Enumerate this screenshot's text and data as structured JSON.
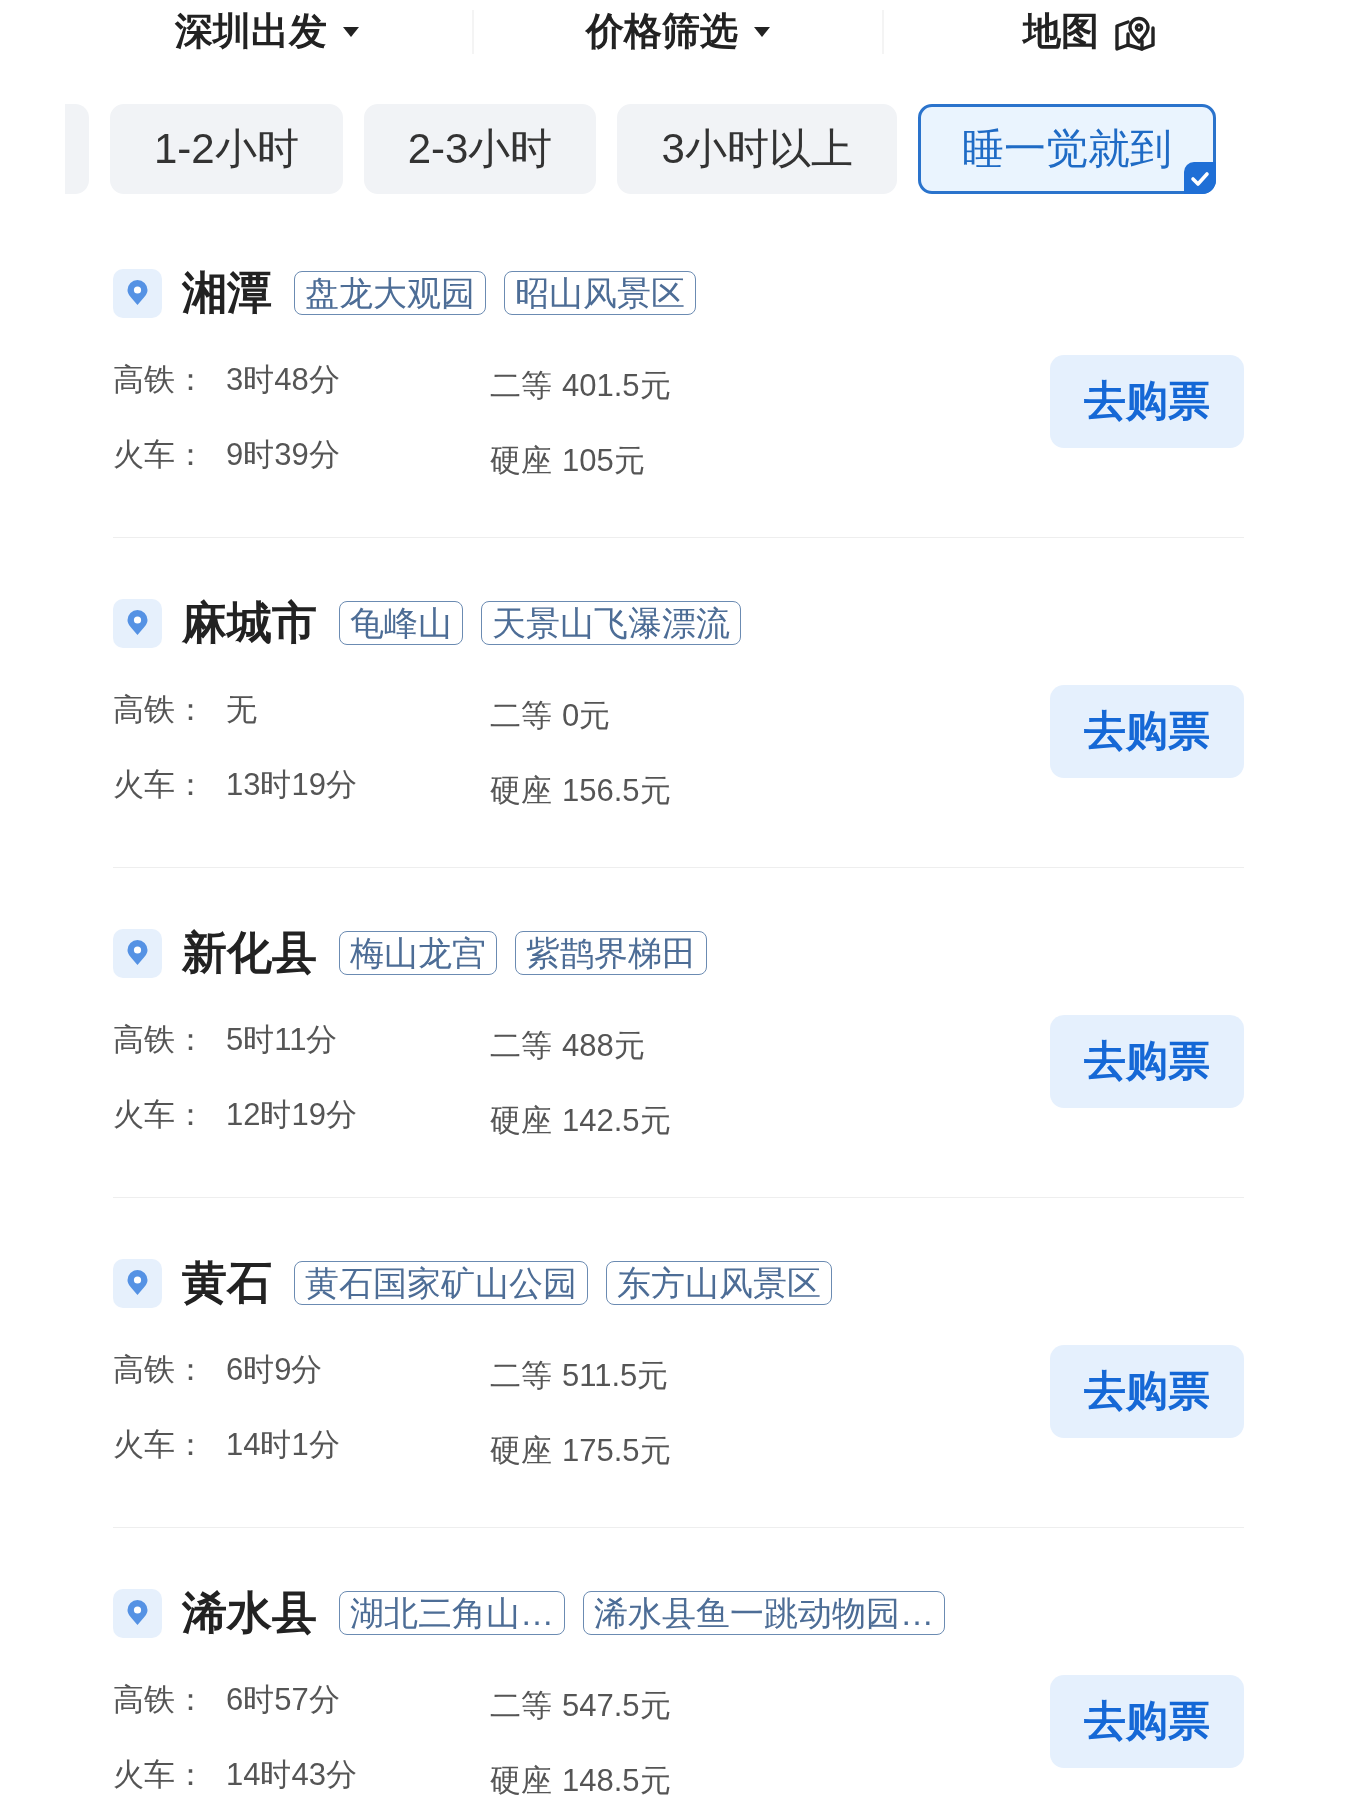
{
  "top_bar": {
    "items": [
      {
        "kind": "dropdown",
        "label": "深圳出发"
      },
      {
        "kind": "dropdown",
        "label": "价格筛选"
      },
      {
        "kind": "map",
        "label": "地图"
      }
    ]
  },
  "duration_filters": [
    {
      "label": "1-2小时",
      "selected": false
    },
    {
      "label": "2-3小时",
      "selected": false
    },
    {
      "label": "3小时以上",
      "selected": false
    },
    {
      "label": "睡一觉就到",
      "selected": true
    }
  ],
  "destinations": [
    {
      "name": "湘潭",
      "tags": [
        "盘龙大观园",
        "昭山风景区"
      ],
      "fares": [
        {
          "label": "高铁：",
          "duration": "3时48分",
          "seat": "二等",
          "price": "401.5元"
        },
        {
          "label": "火车：",
          "duration": "9时39分",
          "seat": "硬座",
          "price": "105元"
        }
      ],
      "button": "去购票"
    },
    {
      "name": "麻城市",
      "tags": [
        "龟峰山",
        "天景山飞瀑漂流"
      ],
      "fares": [
        {
          "label": "高铁：",
          "duration": "无",
          "seat": "二等",
          "price": "0元"
        },
        {
          "label": "火车：",
          "duration": "13时19分",
          "seat": "硬座",
          "price": "156.5元"
        }
      ],
      "button": "去购票"
    },
    {
      "name": "新化县",
      "tags": [
        "梅山龙宫",
        "紫鹊界梯田"
      ],
      "fares": [
        {
          "label": "高铁：",
          "duration": "5时11分",
          "seat": "二等",
          "price": "488元"
        },
        {
          "label": "火车：",
          "duration": "12时19分",
          "seat": "硬座",
          "price": "142.5元"
        }
      ],
      "button": "去购票"
    },
    {
      "name": "黄石",
      "tags": [
        "黄石国家矿山公园",
        "东方山风景区"
      ],
      "fares": [
        {
          "label": "高铁：",
          "duration": "6时9分",
          "seat": "二等",
          "price": "511.5元"
        },
        {
          "label": "火车：",
          "duration": "14时1分",
          "seat": "硬座",
          "price": "175.5元"
        }
      ],
      "button": "去购票"
    },
    {
      "name": "浠水县",
      "tags": [
        "湖北三角山…",
        "浠水县鱼一跳动物园…"
      ],
      "fares": [
        {
          "label": "高铁：",
          "duration": "6时57分",
          "seat": "二等",
          "price": "547.5元"
        },
        {
          "label": "火车：",
          "duration": "14时43分",
          "seat": "硬座",
          "price": "148.5元"
        }
      ],
      "button": "去购票"
    }
  ]
}
